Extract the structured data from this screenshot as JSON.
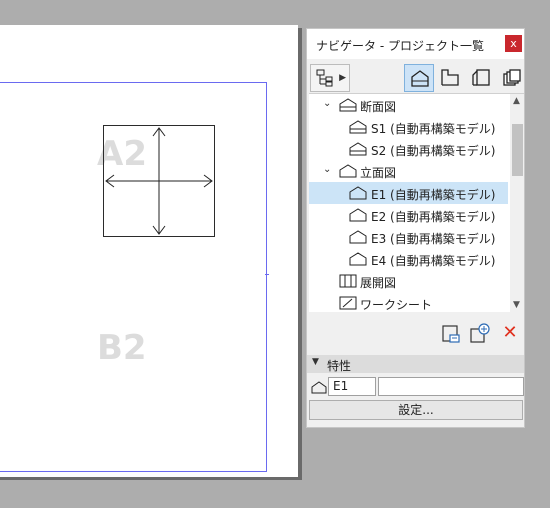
{
  "canvas": {
    "labels": {
      "a2": "A2",
      "b2": "B2"
    }
  },
  "navigator": {
    "title": "ナビゲータ - プロジェクト一覧",
    "close_glyph": "x",
    "toolbar": {
      "menu_icon": "project-map-icon",
      "buttons": [
        {
          "icon": "view-house-icon",
          "active": true
        },
        {
          "icon": "layout-icon",
          "active": false
        },
        {
          "icon": "publisher-icon",
          "active": false
        },
        {
          "icon": "stack-icon",
          "active": false
        }
      ]
    },
    "tree": [
      {
        "label": "断面図",
        "level": 0,
        "expanded": true,
        "icon": "section-folder-icon"
      },
      {
        "label": "S1 (自動再構築モデル)",
        "level": 1,
        "icon": "section-view-icon"
      },
      {
        "label": "S2 (自動再構築モデル)",
        "level": 1,
        "icon": "section-view-icon"
      },
      {
        "label": "立面図",
        "level": 0,
        "expanded": true,
        "icon": "elevation-folder-icon"
      },
      {
        "label": "E1 (自動再構築モデル)",
        "level": 1,
        "icon": "elevation-view-icon",
        "selected": true
      },
      {
        "label": "E2 (自動再構築モデル)",
        "level": 1,
        "icon": "elevation-view-icon"
      },
      {
        "label": "E3 (自動再構築モデル)",
        "level": 1,
        "icon": "elevation-view-icon"
      },
      {
        "label": "E4 (自動再構築モデル)",
        "level": 1,
        "icon": "elevation-view-icon"
      },
      {
        "label": "展開図",
        "level": 0,
        "icon": "interior-elevation-icon"
      },
      {
        "label": "ワークシート",
        "level": 0,
        "icon": "worksheet-icon"
      }
    ],
    "actions": {
      "delete_glyph": "✕"
    },
    "properties": {
      "title": "特性",
      "id_value": "E1",
      "name_value": "",
      "settings_label": "設定..."
    }
  },
  "colors": {
    "selection": "#cce4f7",
    "active_tool": "#cde3f7",
    "close": "#c9272d",
    "delete": "#e0301e",
    "sheet_border": "#6a6af0"
  }
}
